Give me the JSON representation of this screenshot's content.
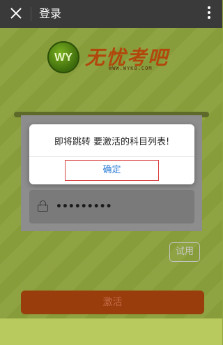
{
  "appbar": {
    "title": "登录"
  },
  "logo": {
    "badge": "WY",
    "brand": "无忧考吧",
    "url": "WWW.WYK8.COM"
  },
  "form": {
    "password_masked": "•••••••••"
  },
  "buttons": {
    "trial": "试用",
    "activate": "激活"
  },
  "dialog": {
    "message": "即将跳转 要激活的科目列表!",
    "confirm": "确定"
  },
  "colors": {
    "accent": "#2a7bd6",
    "brand": "#b2470c",
    "activate": "#993d0d"
  }
}
